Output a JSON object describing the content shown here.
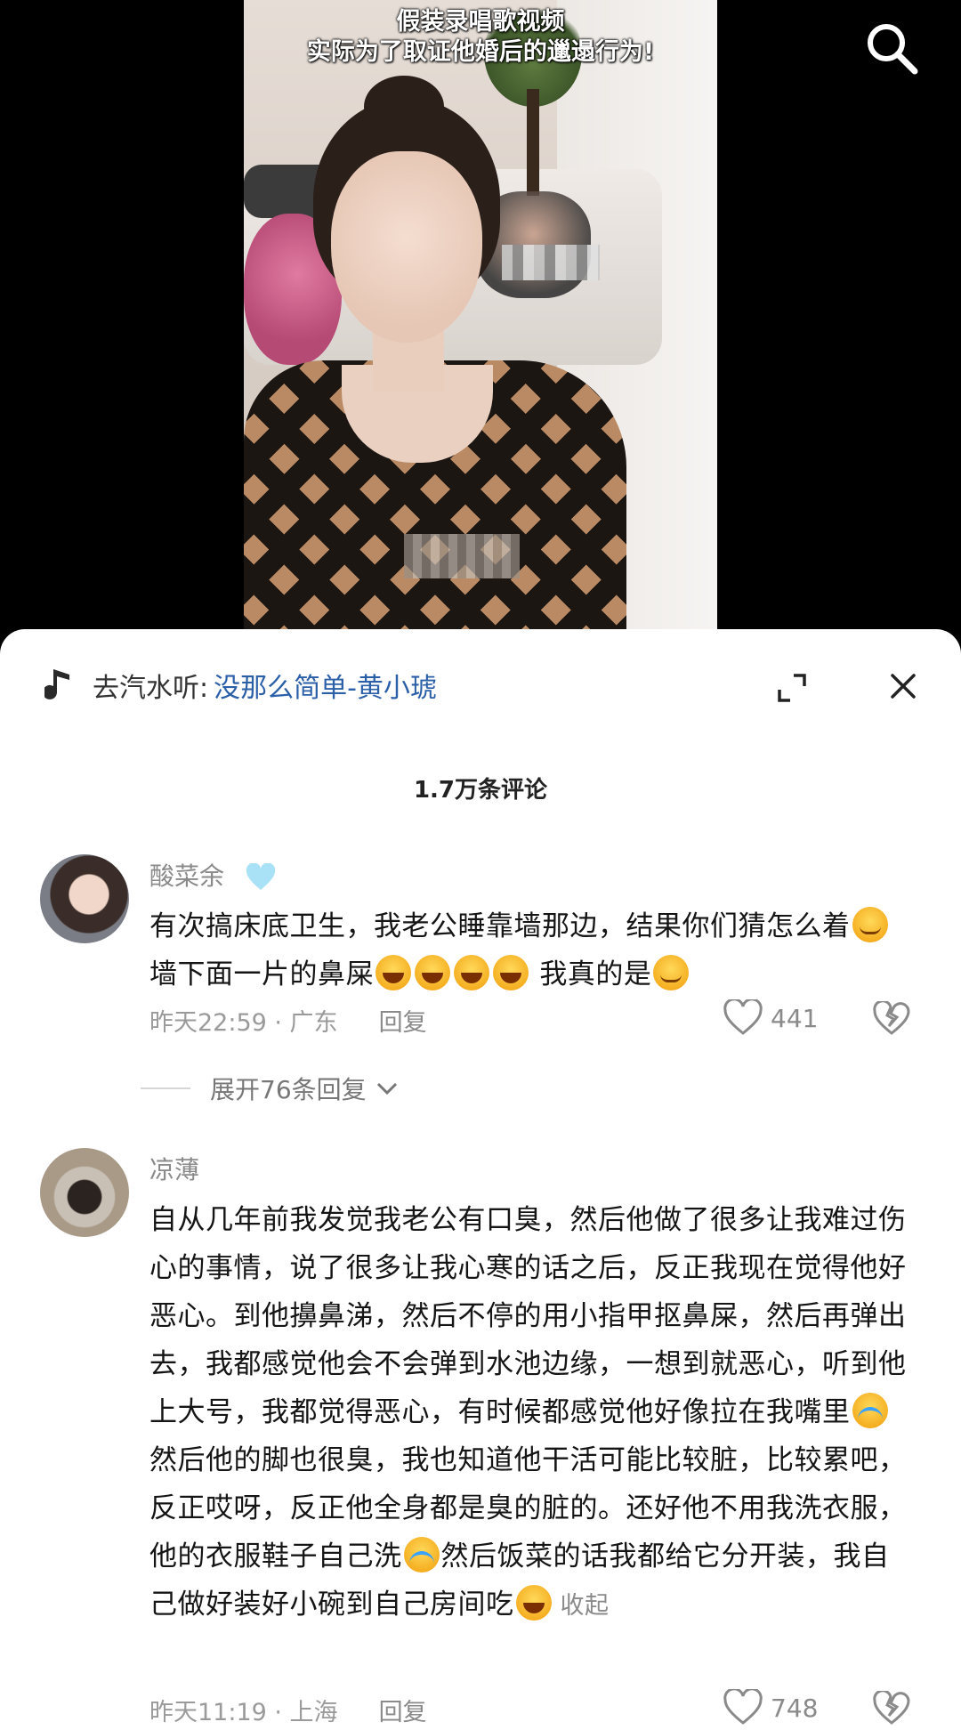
{
  "video": {
    "caption_line1": "假装录唱歌视频",
    "caption_line2": "实际为了取证他婚后的邋遢行为!"
  },
  "music": {
    "prefix": "去汽水听:",
    "song": "没那么简单-黄小琥"
  },
  "comments_header": {
    "count_label": "1.7万条评论"
  },
  "comments": [
    {
      "username": "酸菜余",
      "text_part1": "有次搞床底卫生，我老公睡靠墙那边，结果你们猜怎么着",
      "text_part2": " 墙下面一片的鼻屎",
      "text_part3": " 我真的是",
      "time_location": "昨天22:59 · 广东",
      "reply_label": "回复",
      "likes": "441",
      "expand_label": "展开76条回复"
    },
    {
      "username": "凉薄",
      "text_part1": "自从几年前我发觉我老公有口臭，然后他做了很多让我难过伤心的事情，说了很多让我心寒的话之后，反正我现在觉得他好恶心。到他擤鼻涕，然后不停的用小指甲抠鼻屎，然后再弹出去，我都感觉他会不会弹到水池边缘，一想到就恶心，听到他上大号，我都觉得恶心，有时候都感觉他好像拉在我嘴里",
      "text_part2": "然后他的脚也很臭，我也知道他干活可能比较脏，比较累吧，反正哎呀，反正他全身都是臭的脏的。还好他不用我洗衣服，他的衣服鞋子自己洗",
      "text_part3": "然后饭菜的话我都给它分开装，我自己做好装好小碗到自己房间吃",
      "collapse_label": "收起",
      "time_location": "昨天11:19 · 上海",
      "reply_label": "回复",
      "likes": "748"
    }
  ],
  "colors": {
    "link_blue": "#2b5fa8",
    "meta_gray": "#9a9a9a",
    "badge_blue": "#8fd3f4"
  }
}
